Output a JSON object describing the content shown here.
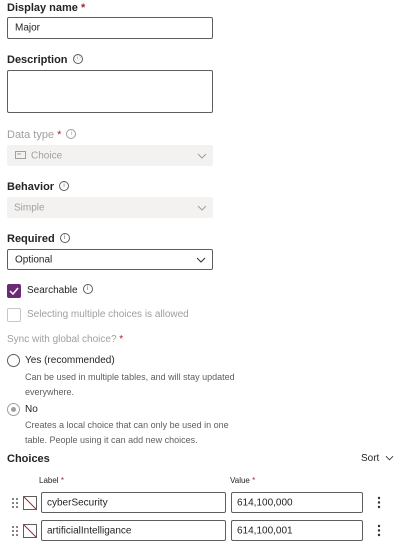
{
  "display_name": {
    "label": "Display name",
    "required": "*",
    "value": "Major"
  },
  "description": {
    "label": "Description",
    "info": "ⓘ",
    "value": ""
  },
  "data_type": {
    "label": "Data type",
    "required": "*",
    "value": "Choice",
    "icon": "choice-icon"
  },
  "behavior": {
    "label": "Behavior",
    "value": "Simple"
  },
  "required_field": {
    "label": "Required",
    "value": "Optional"
  },
  "searchable": {
    "label": "Searchable",
    "checked": true
  },
  "multiple_choices": {
    "label": "Selecting multiple choices is allowed",
    "checked": false
  },
  "sync": {
    "label": "Sync with global choice?",
    "required": "*",
    "yes": {
      "label": "Yes (recommended)",
      "description_line1": "Can be used in multiple tables, and will stay updated",
      "description_line2": "everywhere."
    },
    "no": {
      "label": "No",
      "description_line1": "Creates a local choice that can only be used in one",
      "description_line2": "table. People using it can add new choices.",
      "selected": true
    }
  },
  "choices": {
    "title": "Choices",
    "sort_label": "Sort",
    "label_header": "Label",
    "value_header": "Value",
    "required": "*",
    "rows": [
      {
        "label": "cyberSecurity",
        "value": "614,100,000"
      },
      {
        "label": "artificialIntelligance",
        "value": "614,100,001"
      }
    ]
  },
  "colors": {
    "accent": "#6b2a75",
    "disabled_bg": "#f3f2f1",
    "disabled_text": "#a19f9d",
    "required": "#a4262c"
  }
}
